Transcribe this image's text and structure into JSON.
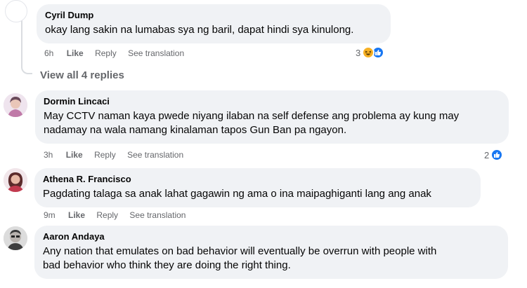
{
  "comments": [
    {
      "author": "Cyril Dump",
      "text": "okay lang sakin na lumabas sya ng baril, dapat hindi sya kinulong.",
      "time": "6h",
      "like": "Like",
      "reply": "Reply",
      "translation": "See translation",
      "reaction_count": "3",
      "reactions": [
        "haha-icon",
        "like-icon"
      ]
    },
    {
      "author": "Dormin Lincaci",
      "text": "May CCTV naman kaya pwede niyang ilaban na self defense ang problema ay kung may\nnadamay na wala namang kinalaman tapos Gun Ban pa ngayon.",
      "time": "3h",
      "like": "Like",
      "reply": "Reply",
      "translation": "See translation",
      "reaction_count": "2",
      "reactions": [
        "like-icon"
      ]
    },
    {
      "author": "Athena R. Francisco",
      "text": "Pagdating talaga sa anak lahat gagawin ng ama o ina maipaghiganti lang ang anak",
      "time": "9m",
      "like": "Like",
      "reply": "Reply",
      "translation": "See translation"
    },
    {
      "author": "Aaron Andaya",
      "text": "Any nation that emulates on bad behavior will eventually be overrun with people with\nbad behavior who think they are doing the right thing."
    }
  ],
  "view_replies": "View all 4 replies",
  "colors": {
    "bubble": "#f0f2f5",
    "meta_text": "#65676b",
    "like_blue": "#1877f2",
    "haha_yellow": "#f7b125"
  }
}
